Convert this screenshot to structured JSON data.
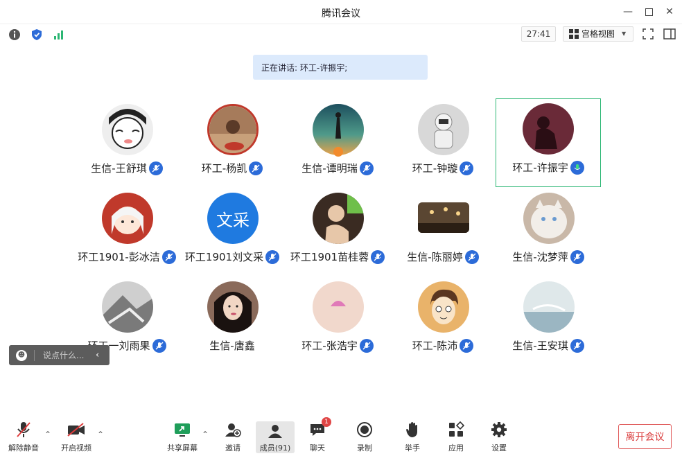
{
  "window": {
    "title": "腾讯会议"
  },
  "toolbar": {
    "timer": "27:41",
    "view_label": "宫格视图"
  },
  "banner": {
    "text": "正在讲话: 环工-许振宇;"
  },
  "participants": [
    {
      "name": "生信-王舒琪",
      "initials": ""
    },
    {
      "name": "环工-杨凯",
      "initials": ""
    },
    {
      "name": "生信-谭明瑞",
      "initials": ""
    },
    {
      "name": "环工-钟璇",
      "initials": ""
    },
    {
      "name": "环工-许振宇",
      "initials": ""
    },
    {
      "name": "环工1901-彭冰洁",
      "initials": ""
    },
    {
      "name": "环工1901刘文采",
      "initials": "文采"
    },
    {
      "name": "环工1901苗桂蓉",
      "initials": ""
    },
    {
      "name": "生信-陈丽婷",
      "initials": ""
    },
    {
      "name": "生信-沈梦萍",
      "initials": ""
    },
    {
      "name": "环工一刘雨果",
      "initials": ""
    },
    {
      "name": "生信-唐鑫",
      "initials": ""
    },
    {
      "name": "环工-张浩宇",
      "initials": ""
    },
    {
      "name": "环工-陈沛",
      "initials": ""
    },
    {
      "name": "生信-王安琪",
      "initials": ""
    }
  ],
  "chat": {
    "placeholder": "说点什么..."
  },
  "bottom": {
    "unmute": "解除静音",
    "start_video": "开启视频",
    "share_screen": "共享屏幕",
    "invite": "邀请",
    "members": "成员(91)",
    "chat": "聊天",
    "chat_badge": "1",
    "record": "录制",
    "raise_hand": "举手",
    "apps": "应用",
    "settings": "设置",
    "leave": "离开会议"
  },
  "colors": {
    "accent": "#2c6bd8",
    "active_border": "#2bb673",
    "leave": "#d93a3a",
    "banner_bg": "#dceafc"
  }
}
